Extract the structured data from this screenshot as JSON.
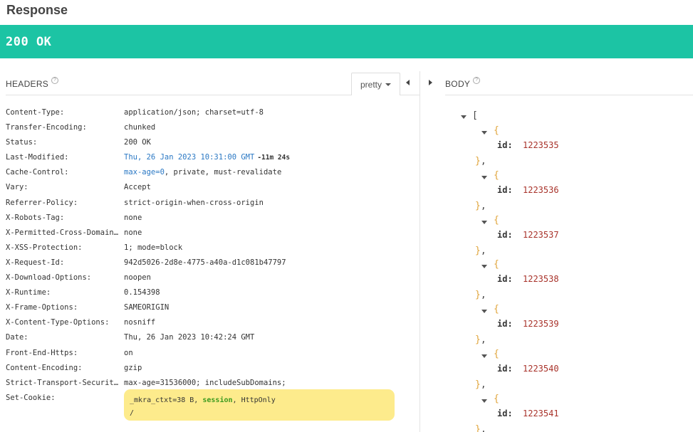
{
  "title": "Response",
  "status": "200 OK",
  "headers_pane": {
    "label": "HEADERS",
    "help_icon": "?",
    "format_select": "pretty",
    "rows": [
      {
        "name": "Content-Type:",
        "value": "application/json; charset=utf-8"
      },
      {
        "name": "Transfer-Encoding:",
        "value": "chunked"
      },
      {
        "name": "Status:",
        "value": "200 OK"
      },
      {
        "name": "Last-Modified:",
        "value": "Thu, 26 Jan 2023 10:31:00 GMT",
        "extra": "-11m 24s"
      },
      {
        "name": "Cache-Control:",
        "value_link": "max-age=0",
        "value": ", private, must-revalidate"
      },
      {
        "name": "Vary:",
        "value": "Accept"
      },
      {
        "name": "Referrer-Policy:",
        "value": "strict-origin-when-cross-origin"
      },
      {
        "name": "X-Robots-Tag:",
        "value": "none"
      },
      {
        "name": "X-Permitted-Cross-Domain-Policies:",
        "value": "none"
      },
      {
        "name": "X-XSS-Protection:",
        "value": "1; mode=block"
      },
      {
        "name": "X-Request-Id:",
        "value": "942d5026-2d8e-4775-a40a-d1c081b47797"
      },
      {
        "name": "X-Download-Options:",
        "value": "noopen"
      },
      {
        "name": "X-Runtime:",
        "value": "0.154398"
      },
      {
        "name": "X-Frame-Options:",
        "value": "SAMEORIGIN"
      },
      {
        "name": "X-Content-Type-Options:",
        "value": "nosniff"
      },
      {
        "name": "Date:",
        "value": "Thu, 26 Jan 2023 10:42:24 GMT"
      },
      {
        "name": "Front-End-Https:",
        "value": "on"
      },
      {
        "name": "Content-Encoding:",
        "value": "gzip"
      },
      {
        "name": "Strict-Transport-Security:",
        "value": "max-age=31536000; includeSubDomains;"
      },
      {
        "name": "Set-Cookie:",
        "cookie": {
          "prefix": "_mkra_ctxt=38 B, ",
          "session": "session",
          "sep": ", ",
          "flag": "HttpOnly",
          "path": "/"
        }
      }
    ]
  },
  "body_pane": {
    "label": "BODY",
    "help_icon": "?",
    "open_bracket": "[",
    "open_brace": "{",
    "close_brace": "}",
    "comma": ",",
    "key": "id:",
    "items": [
      "1223535",
      "1223536",
      "1223537",
      "1223538",
      "1223539",
      "1223540",
      "1223541"
    ]
  },
  "colors": {
    "status_ok": "#1cc4a4",
    "cookie_bg": "#fdeb8c",
    "link": "#2a78c4",
    "json_brace": "#e0a43a",
    "json_number": "#a8322a"
  }
}
